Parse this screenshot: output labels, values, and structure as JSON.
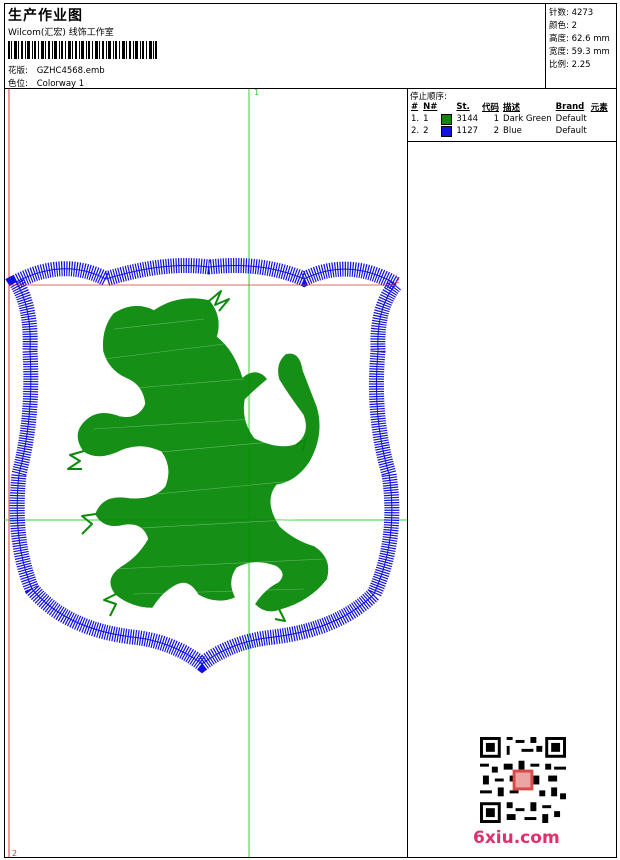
{
  "header": {
    "title": "生产作业图",
    "studio": "Wilcom(汇宏) 线饰工作室",
    "design_label": "花版:",
    "design_value": "GZHC4568.emb",
    "colorway_label": "色位:",
    "colorway_value": "Colorway 1"
  },
  "stats": {
    "stitches_label": "针数:",
    "stitches_value": "4273",
    "colors_label": "颜色:",
    "colors_value": "2",
    "height_label": "高度:",
    "height_value": "62.6 mm",
    "width_label": "宽度:",
    "width_value": "59.3 mm",
    "scale_label": "比例:",
    "scale_value": "2.25"
  },
  "stop_sequence": {
    "title": "停止顺序:",
    "headers": [
      "#",
      "N#",
      "St.",
      "代码",
      "描述",
      "Brand",
      "元素"
    ],
    "rows": [
      {
        "index": "1.",
        "needle": "1",
        "color": "#0a8a0a",
        "stitches": "3144",
        "code": "1",
        "description": "Dark Green",
        "brand": "Default"
      },
      {
        "index": "2.",
        "needle": "2",
        "color": "#1010e0",
        "stitches": "1127",
        "code": "2",
        "description": "Blue",
        "brand": "Default"
      }
    ]
  },
  "markers": {
    "top": "1",
    "right": "2",
    "bottom_left": "2"
  },
  "watermark": "6xiu.com",
  "colors": {
    "green": "#0a8a0a",
    "blue": "#1010e0",
    "guide_green": "#2fd42f",
    "guide_red": "#e03030"
  }
}
